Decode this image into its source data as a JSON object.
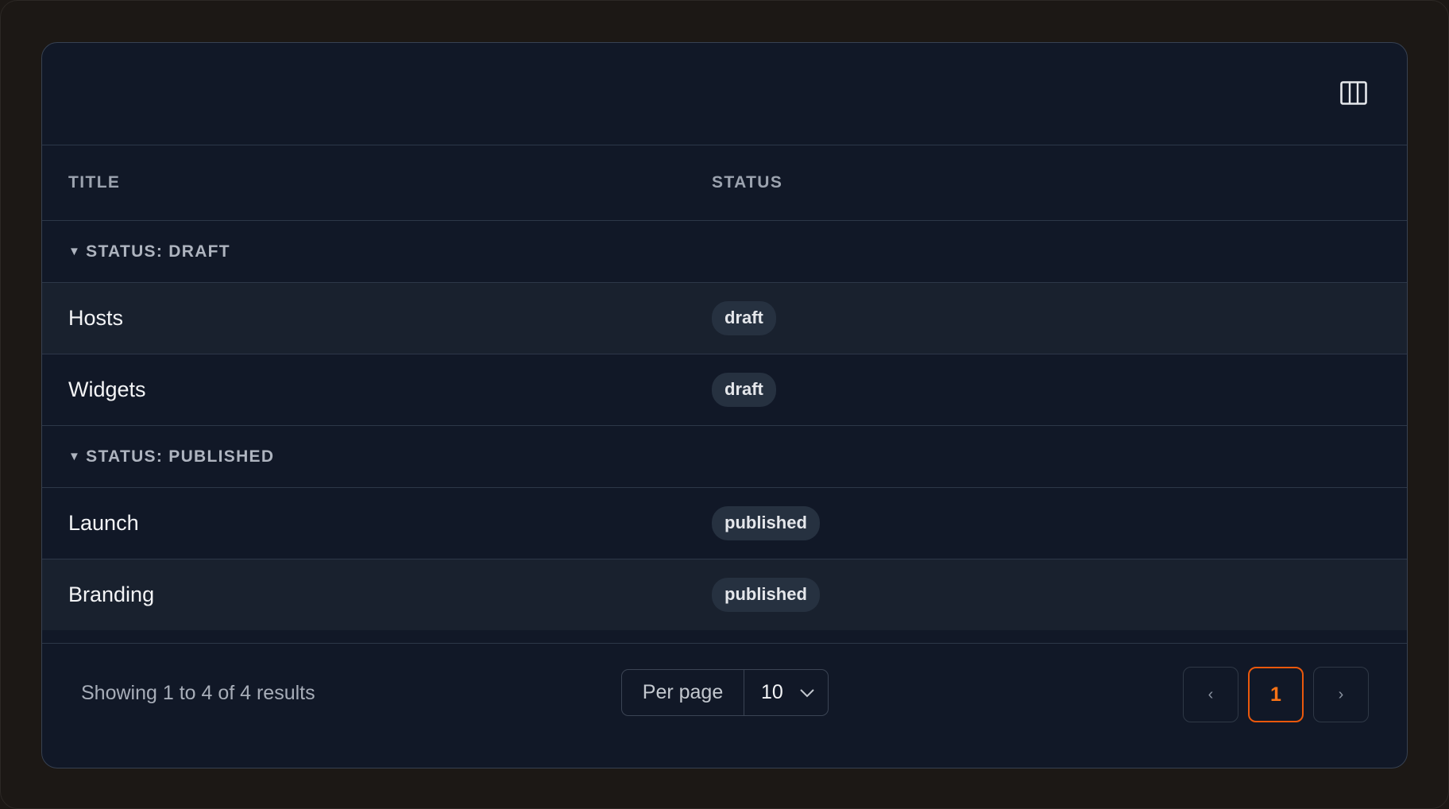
{
  "table": {
    "columns": {
      "title": "TITLE",
      "status": "STATUS"
    },
    "groups": [
      {
        "label": "STATUS: DRAFT",
        "rows": [
          {
            "title": "Hosts",
            "status": "draft"
          },
          {
            "title": "Widgets",
            "status": "draft"
          }
        ]
      },
      {
        "label": "STATUS: PUBLISHED",
        "rows": [
          {
            "title": "Launch",
            "status": "published"
          },
          {
            "title": "Branding",
            "status": "published"
          }
        ]
      }
    ]
  },
  "icons": {
    "columns_toggle": "columns-icon",
    "group_caret": "caret-down-icon",
    "select_chevron": "chevron-down-icon"
  },
  "footer": {
    "summary": "Showing 1 to 4 of 4 results",
    "per_page_label": "Per page",
    "per_page_value": "10",
    "pagination": {
      "prev": "‹",
      "current": "1",
      "next": "›"
    }
  },
  "colors": {
    "accent": "#f97316",
    "card_bg": "#111827",
    "badge_bg": "#263140"
  }
}
